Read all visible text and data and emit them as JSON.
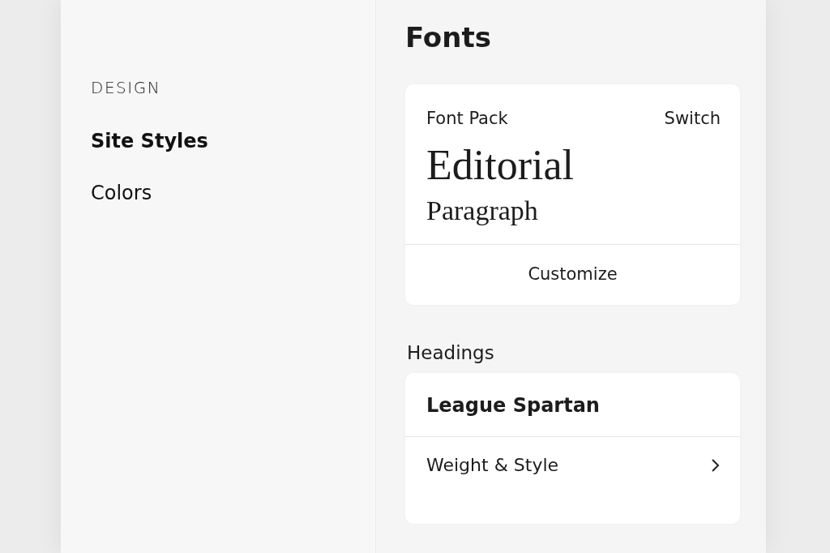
{
  "sidebar": {
    "heading": "DESIGN",
    "items": [
      {
        "label": "Site Styles",
        "selected": true
      },
      {
        "label": "Colors",
        "selected": false
      }
    ]
  },
  "panel": {
    "title": "Fonts",
    "font_pack": {
      "label": "Font Pack",
      "action": "Switch",
      "heading_sample": "Editorial",
      "paragraph_sample": "Paragraph",
      "button": "Customize"
    },
    "sections": [
      {
        "title": "Headings",
        "font": "League Spartan",
        "rows": [
          {
            "label": "Weight & Style",
            "kind": "link"
          }
        ]
      }
    ]
  }
}
